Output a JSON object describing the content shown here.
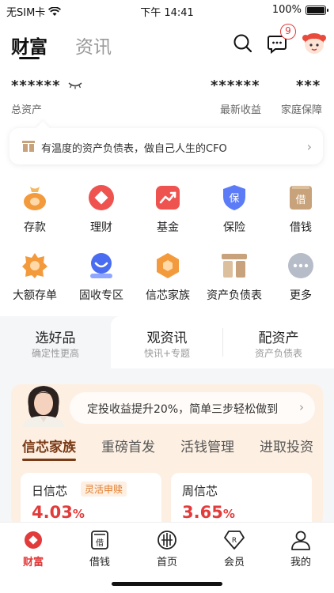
{
  "status": {
    "carrier": "无SIM卡",
    "time": "下午 14:41",
    "battery_text": "100%",
    "battery_level": 1.0
  },
  "header": {
    "tabs": [
      {
        "label": "财富",
        "active": true
      },
      {
        "label": "资讯",
        "active": false
      }
    ],
    "icons": [
      "search-icon",
      "message-icon",
      "avatar-icon"
    ],
    "message_badge": "9"
  },
  "assets": {
    "total_value": "******",
    "total_label": "总资产",
    "latest_value": "******",
    "latest_label": "最新收益",
    "family_value": "***",
    "family_label": "家庭保障"
  },
  "banner": {
    "text": "有温度的资产负债表，做自己人生的CFO",
    "icon": "book-icon"
  },
  "grid": [
    {
      "label": "存款",
      "icon": "deposit-bag-icon",
      "color": "#f39a3d"
    },
    {
      "label": "理财",
      "icon": "diamond-icon",
      "color": "#ef5350"
    },
    {
      "label": "基金",
      "icon": "trend-up-icon",
      "color": "#ef5350"
    },
    {
      "label": "保险",
      "icon": "shield-icon",
      "color": "#5c7cf7"
    },
    {
      "label": "借钱",
      "icon": "borrow-book-icon",
      "color": "#c7a27a"
    },
    {
      "label": "大额存单",
      "icon": "star-badge-icon",
      "color": "#f39a3d"
    },
    {
      "label": "固收专区",
      "icon": "fixed-income-icon",
      "color": "#4a6cf0"
    },
    {
      "label": "信芯家族",
      "icon": "hexagon-icon",
      "color": "#f39a3d"
    },
    {
      "label": "资产负债表",
      "icon": "balance-sheet-icon",
      "color": "#c7a27a"
    },
    {
      "label": "更多",
      "icon": "more-dots-icon",
      "color": "#b7bcc9"
    }
  ],
  "segments": [
    {
      "title": "选好品",
      "subtitle": "确定性更高",
      "active": true
    },
    {
      "title": "观资讯",
      "subtitle": "快讯+专题",
      "active": false
    },
    {
      "title": "配资产",
      "subtitle": "资产负债表",
      "active": false
    }
  ],
  "promo": {
    "bubble_text": "定投收益提升20%，简单三步轻松做到",
    "tabs": [
      "信芯家族",
      "重磅首发",
      "活钱管理",
      "进取投资"
    ],
    "cards": [
      {
        "name": "日信芯",
        "tag": "灵活申赎",
        "rate": "4.03",
        "unit": "%"
      },
      {
        "name": "周信芯",
        "tag": "",
        "rate": "3.65",
        "unit": "%"
      }
    ]
  },
  "nav": [
    {
      "label": "财富",
      "icon": "wealth-icon",
      "active": true
    },
    {
      "label": "借钱",
      "icon": "borrow-icon",
      "active": false
    },
    {
      "label": "首页",
      "icon": "home-logo-icon",
      "active": false
    },
    {
      "label": "会员",
      "icon": "member-icon",
      "active": false
    },
    {
      "label": "我的",
      "icon": "profile-icon",
      "active": false
    }
  ],
  "colors": {
    "accent": "#e23b3b",
    "brown_accent": "#7a3a16",
    "promo_bg": "#fdf0e3"
  }
}
